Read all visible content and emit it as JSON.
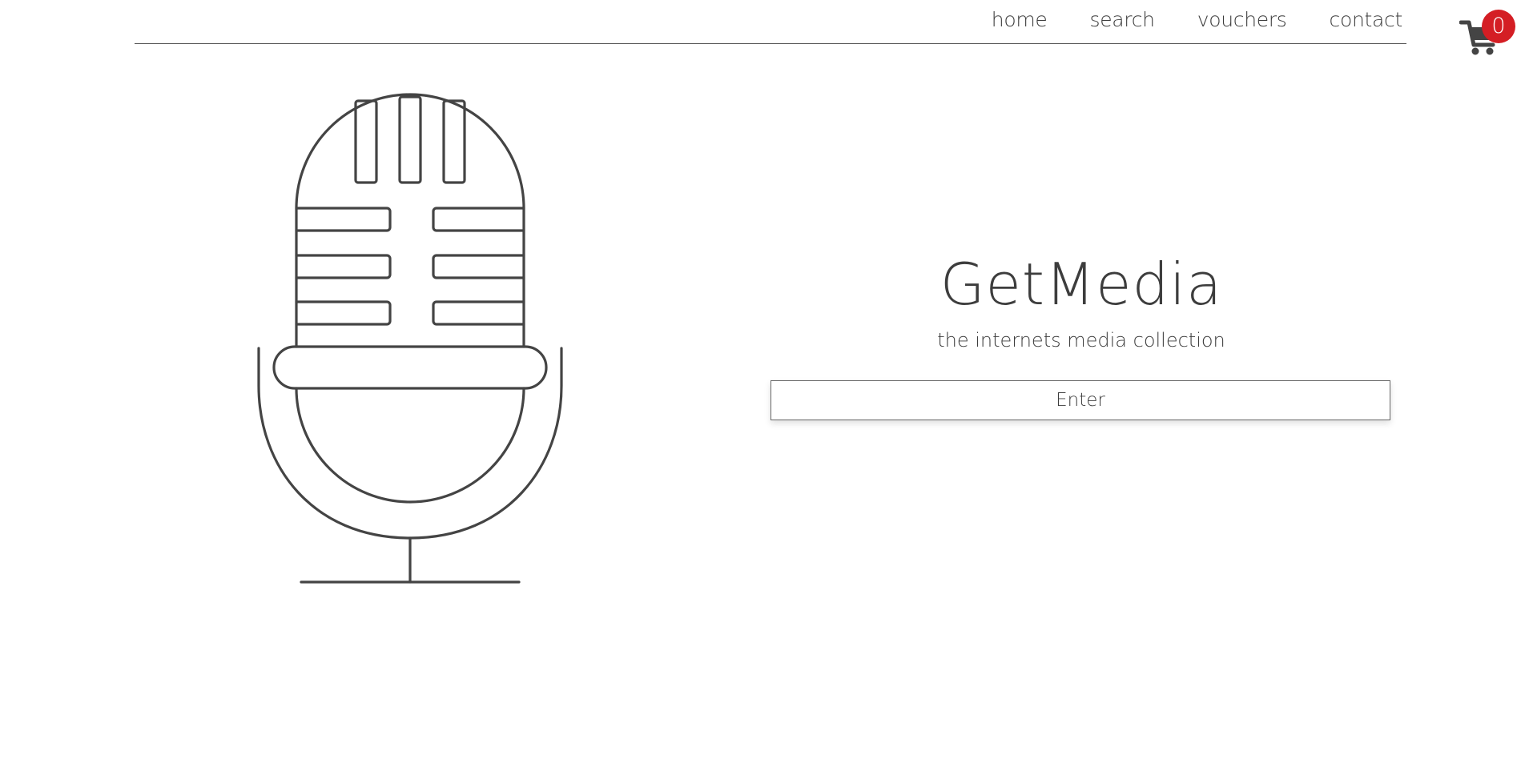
{
  "nav": {
    "items": [
      {
        "label": "home"
      },
      {
        "label": "search"
      },
      {
        "label": "vouchers"
      },
      {
        "label": "contact"
      }
    ]
  },
  "cart": {
    "count": "0",
    "icon": "shopping-cart-icon",
    "badge_color": "#d41e24"
  },
  "illustration": {
    "icon": "microphone-icon"
  },
  "hero": {
    "title": "GetMedia",
    "subtitle": "the internets media collection",
    "button_label": "Enter"
  },
  "colors": {
    "text": "#3d3d3d",
    "accent": "#d41e24",
    "background": "#ffffff"
  }
}
